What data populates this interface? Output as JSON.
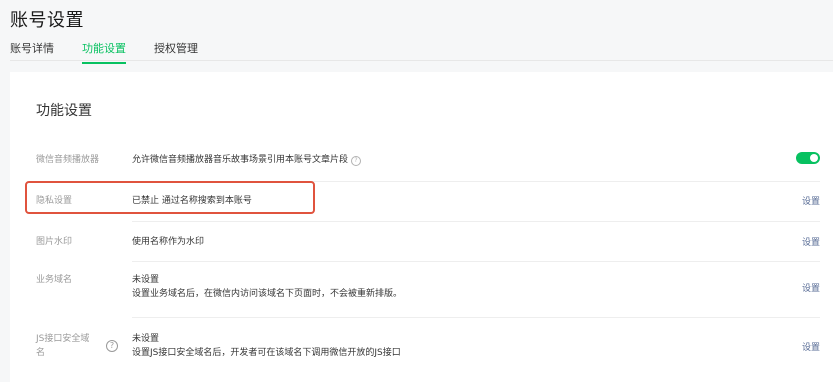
{
  "header": {
    "title": "账号设置"
  },
  "tabs": [
    {
      "label": "账号详情",
      "active": false
    },
    {
      "label": "功能设置",
      "active": true
    },
    {
      "label": "授权管理",
      "active": false
    }
  ],
  "section": {
    "title": "功能设置"
  },
  "rows": {
    "music": {
      "label": "微信音频播放器",
      "value": "允许微信音频播放器音乐故事场景引用本账号文章片段",
      "help_icon": "question-circle-icon",
      "toggle_on": true
    },
    "privacy": {
      "label": "隐私设置",
      "value": "已禁止 通过名称搜索到本账号",
      "action": "设置"
    },
    "watermark": {
      "label": "图片水印",
      "value": "使用名称作为水印",
      "action": "设置"
    },
    "business_domain": {
      "label": "业务域名",
      "value": "未设置",
      "desc": "设置业务域名后，在微信内访问该域名下页面时，不会被重新排版。",
      "action": "设置"
    },
    "js_domain": {
      "label_line1": "JS接口安全域",
      "label_line2": "名",
      "help_icon": "question-circle-icon",
      "value": "未设置",
      "desc": "设置JS接口安全域名后，开发者可在该域名下调用微信开放的JS接口",
      "action": "设置"
    }
  },
  "colors": {
    "accent": "#07c160",
    "link": "#576b95",
    "highlight": "#e0533e"
  }
}
